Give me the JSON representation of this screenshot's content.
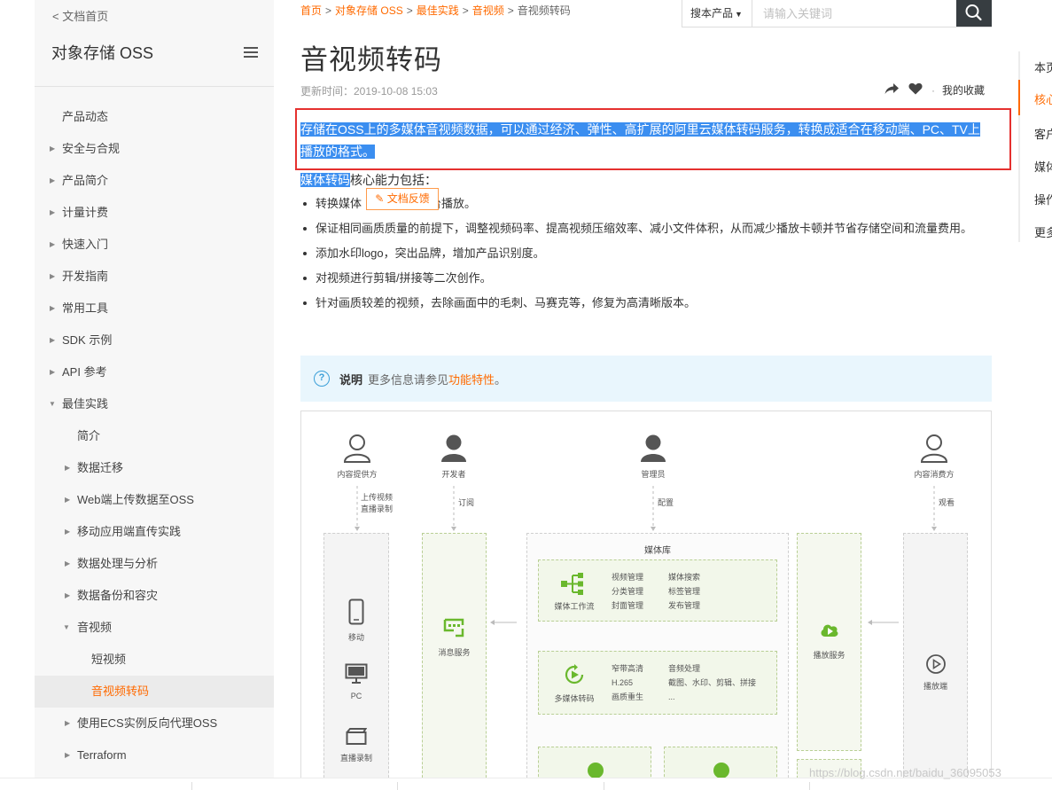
{
  "sidebar": {
    "back_label": "< 文档首页",
    "product_title": "对象存储 OSS",
    "items": [
      {
        "label": "产品动态",
        "level": 1,
        "arrow": "none"
      },
      {
        "label": "安全与合规",
        "level": 1,
        "arrow": "right"
      },
      {
        "label": "产品简介",
        "level": 1,
        "arrow": "right"
      },
      {
        "label": "计量计费",
        "level": 1,
        "arrow": "right"
      },
      {
        "label": "快速入门",
        "level": 1,
        "arrow": "right"
      },
      {
        "label": "开发指南",
        "level": 1,
        "arrow": "right"
      },
      {
        "label": "常用工具",
        "level": 1,
        "arrow": "right"
      },
      {
        "label": "SDK 示例",
        "level": 1,
        "arrow": "right"
      },
      {
        "label": "API 参考",
        "level": 1,
        "arrow": "right"
      },
      {
        "label": "最佳实践",
        "level": 1,
        "arrow": "down"
      },
      {
        "label": "简介",
        "level": 2,
        "arrow": "none"
      },
      {
        "label": "数据迁移",
        "level": 2,
        "arrow": "right"
      },
      {
        "label": "Web端上传数据至OSS",
        "level": 2,
        "arrow": "right"
      },
      {
        "label": "移动应用端直传实践",
        "level": 2,
        "arrow": "right"
      },
      {
        "label": "数据处理与分析",
        "level": 2,
        "arrow": "right"
      },
      {
        "label": "数据备份和容灾",
        "level": 2,
        "arrow": "right"
      },
      {
        "label": "音视频",
        "level": 2,
        "arrow": "down"
      },
      {
        "label": "短视频",
        "level": 3,
        "arrow": "none"
      },
      {
        "label": "音视频转码",
        "level": 3,
        "arrow": "none",
        "active": true
      },
      {
        "label": "使用ECS实例反向代理OSS",
        "level": 2,
        "arrow": "right"
      },
      {
        "label": "Terraform",
        "level": 2,
        "arrow": "right"
      }
    ]
  },
  "search": {
    "scope_label": "搜本产品",
    "placeholder": "请输入关键词"
  },
  "breadcrumb": {
    "items": [
      "首页",
      "对象存储 OSS",
      "最佳实践",
      "音视频"
    ],
    "separator": ">",
    "current": "音视频转码"
  },
  "article": {
    "title": "音视频转码",
    "updated": "更新时间：2019-10-08 15:03",
    "my_favorites": "我的收藏",
    "intro_line1": "存储在OSS上的多媒体音视频数据，可以通过经济、弹性、高扩展的阿里云媒体转码服务，转换成适合在移动端、PC、TV上",
    "intro_line2": "播放的格式。",
    "subhead_hl": "媒体转码",
    "subhead_rest": "核心能力包括：",
    "feedback_label": "文档反馈",
    "bullets": [
      "转换媒体格式，支持多平台播放。",
      "保证相同画质质量的前提下，调整视频码率、提高视频压缩效率、减小文件体积，从而减少播放卡顿并节省存储空间和流量费用。",
      "添加水印logo，突出品牌，增加产品识别度。",
      "对视频进行剪辑/拼接等二次创作。",
      "针对画质较差的视频，去除画面中的毛刺、马赛克等，修复为高清晰版本。"
    ],
    "bullet1_visible": "转换媒体",
    "bullet1_tail": "平台播放。",
    "note_label": "说明",
    "note_text": "更多信息请参见",
    "note_link": "功能特性",
    "note_end": "。"
  },
  "diagram": {
    "roles": [
      "内容提供方",
      "开发者",
      "管理员",
      "内容消费方"
    ],
    "role_actions": {
      "provider": [
        "上传视频",
        "直播录制"
      ],
      "developer": "订阅",
      "admin": "配置",
      "consumer": "观看"
    },
    "media_lib_title": "媒体库",
    "workflow_label": "媒体工作流",
    "workflow_features_left": [
      "视频管理",
      "分类管理",
      "封面管理"
    ],
    "workflow_features_right": [
      "媒体搜索",
      "标签管理",
      "发布管理"
    ],
    "transcode_label": "多媒体转码",
    "transcode_features_left": [
      "窄带高清",
      "H.265",
      "画质重生"
    ],
    "transcode_features_right": [
      "音频处理",
      "截图、水印、剪辑、拼接",
      "..."
    ],
    "message_service": "消息服务",
    "play_service": "播放服务",
    "player_label": "播放端",
    "devices": [
      "移动",
      "PC",
      "直播录制"
    ]
  },
  "toc": {
    "items": [
      "本页目录",
      "核心能力",
      "客户案例",
      "媒体处理",
      "操作步骤",
      "更多信息"
    ],
    "active_index": 1
  },
  "watermark": "https://blog.csdn.net/baidu_36095053",
  "colors": {
    "accent": "#ff6a00",
    "highlight": "#3b8ef0",
    "red_box": "#e5312f",
    "note_bg": "#e9f6fd",
    "search_button": "#373d41"
  }
}
